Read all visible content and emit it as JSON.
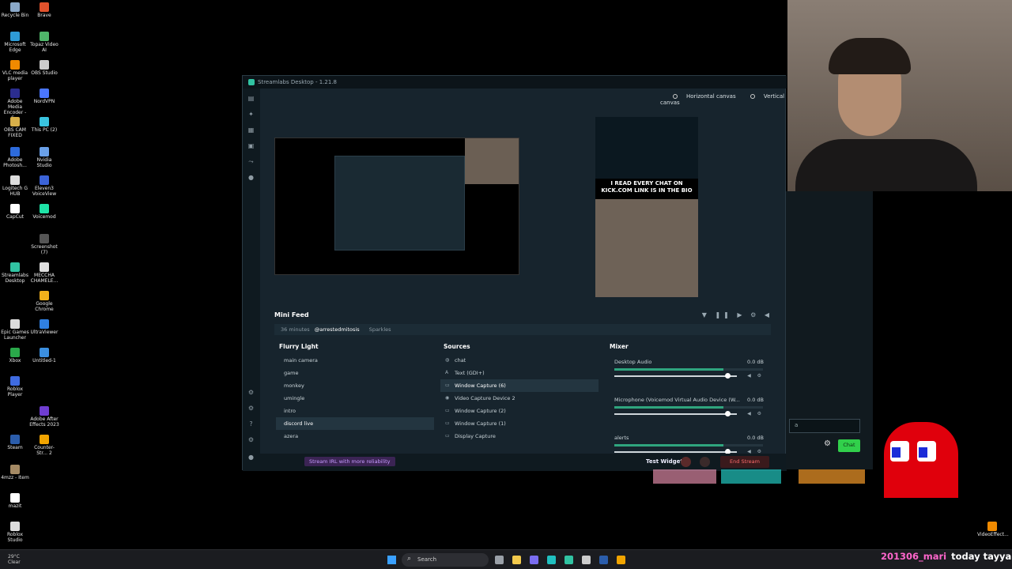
{
  "desktop": {
    "icons": [
      {
        "label": "Recycle Bin",
        "color": "#8aa8c8"
      },
      {
        "label": "Brave",
        "color": "#e2522c"
      },
      {
        "label": "Microsoft Edge",
        "color": "#2e9bd6"
      },
      {
        "label": "Topaz Video AI",
        "color": "#4fb66a"
      },
      {
        "label": "VLC media player",
        "color": "#f08a00"
      },
      {
        "label": "OBS Studio",
        "color": "#cccccc"
      },
      {
        "label": "Adobe Media Encoder - S...",
        "color": "#2b2d8f"
      },
      {
        "label": "NordVPN",
        "color": "#4a76ff"
      },
      {
        "label": "OBS CAM FIXED",
        "color": "#d8b04a"
      },
      {
        "label": "This PC (2)",
        "color": "#3ac4e0"
      },
      {
        "label": "Adobe Photosh...",
        "color": "#2d6bdc"
      },
      {
        "label": "Nvidia Studio",
        "color": "#6aa0e8"
      },
      {
        "label": "Logitech G HUB",
        "color": "#dddddd"
      },
      {
        "label": "Eleven3 VoiceView",
        "color": "#3b63d8"
      },
      {
        "label": "CapCut",
        "color": "#ffffff"
      },
      {
        "label": "Voicemod",
        "color": "#1ee3a7"
      },
      {
        "label": "Screenshot (7)",
        "color": "#555555"
      },
      {
        "label": "Streamlabs Desktop",
        "color": "#31c3a2"
      },
      {
        "label": "MECCHA CHAMELE...",
        "color": "#dddddd"
      },
      {
        "label": "Google Chrome",
        "color": "#f2b11b"
      },
      {
        "label": "Epic Games Launcher",
        "color": "#dddddd"
      },
      {
        "label": "UltraViewer",
        "color": "#2f7fe0"
      },
      {
        "label": "Xbox",
        "color": "#2aa84a"
      },
      {
        "label": "Untitled-1",
        "color": "#3b8fe0"
      },
      {
        "label": "Roblox Player",
        "color": "#3f6be0"
      },
      {
        "label": "Adobe After Effects 2023",
        "color": "#6f3dd1"
      },
      {
        "label": "Steam",
        "color": "#2b5dab"
      },
      {
        "label": "Counter-Str... 2",
        "color": "#f1a400"
      },
      {
        "label": "4mzz - Item",
        "color": "#a58a64"
      },
      {
        "label": "mazit",
        "color": "#ffffff"
      },
      {
        "label": "Roblox Studio",
        "color": "#dddddd"
      },
      {
        "label": "VideoEffect...",
        "color": "#f08a00"
      }
    ]
  },
  "streamlabs": {
    "title": "Streamlabs Desktop - 1.21.8",
    "canvas_tabs": {
      "horizontal": "Horizontal canvas",
      "vertical": "Vertical canvas"
    },
    "vertical_caption": "I READ EVERY CHAT ON KICK.COM LINK IS IN THE BIO",
    "mini_feed": {
      "title": "Mini Feed",
      "time": "36 minutes",
      "user": "@arrestedmitosis",
      "kind": "Sparkles"
    },
    "scenes": {
      "title": "Flurry Light",
      "items": [
        "main camera",
        "game",
        "monkey",
        "umingle",
        "intro",
        "discord live",
        "azera"
      ],
      "selected_index": 5
    },
    "sources": {
      "title": "Sources",
      "items": [
        {
          "label": "chat",
          "icon": "globe-icon"
        },
        {
          "label": "Text (GDI+)",
          "icon": "text-icon"
        },
        {
          "label": "Window Capture (6)",
          "icon": "window-icon"
        },
        {
          "label": "Video Capture Device 2",
          "icon": "camera-icon"
        },
        {
          "label": "Window Capture (2)",
          "icon": "window-icon"
        },
        {
          "label": "Window Capture (1)",
          "icon": "window-icon"
        },
        {
          "label": "Display Capture",
          "icon": "monitor-icon"
        }
      ],
      "selected_index": 2
    },
    "mixer": {
      "title": "Mixer",
      "channels": [
        {
          "name": "Desktop Audio",
          "db": "0.0 dB",
          "level": 0.92
        },
        {
          "name": "Microphone (Voicemod Virtual Audio Device (W...",
          "db": "0.0 dB",
          "level": 0.92
        },
        {
          "name": "alerts",
          "db": "0.0 dB",
          "level": 0.92
        }
      ]
    },
    "footer": {
      "irl": "Stream IRL with more reliability",
      "test_widgets": "Test Widgets",
      "end_stream": "End Stream"
    }
  },
  "chat": {
    "input_placeholder": "a",
    "button": "Chat"
  },
  "taskbar": {
    "temp": "29°C",
    "condition": "Clear",
    "search": "Search"
  },
  "overlay": {
    "user": "201306_mari",
    "message": "today tayyab is lo"
  },
  "colors": {
    "accent": "#31c3a2",
    "chat_button": "#31d04b",
    "overlay_name": "#ff66cc"
  }
}
